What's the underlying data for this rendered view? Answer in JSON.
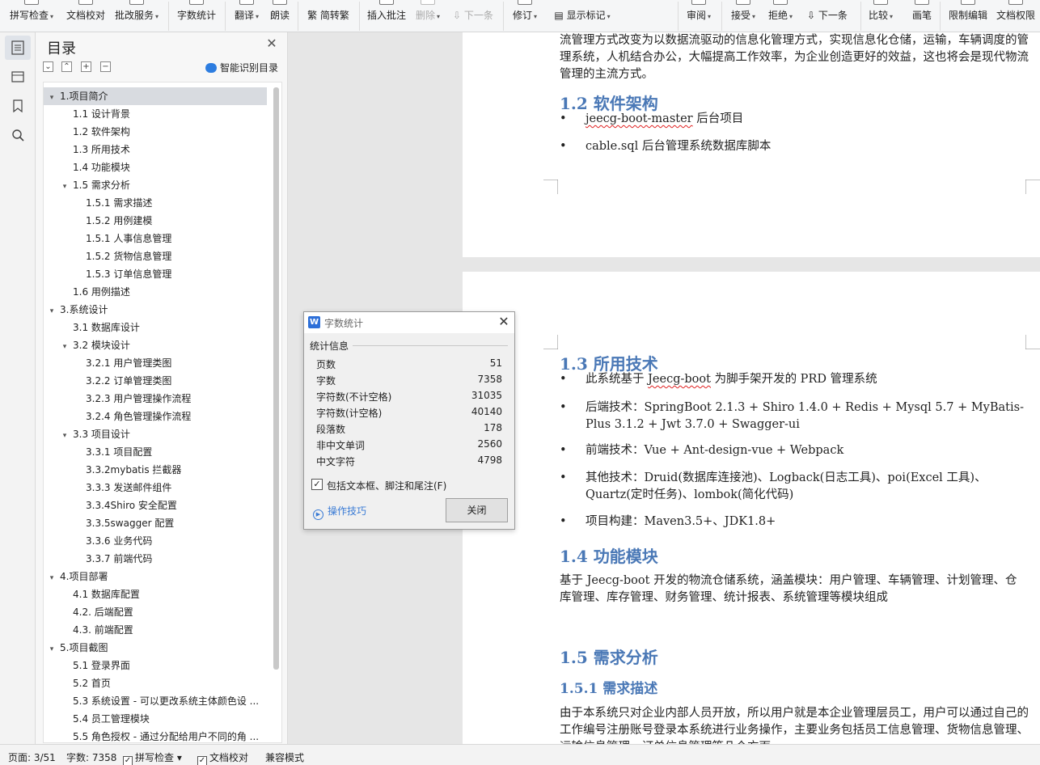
{
  "ribbon": {
    "spellcheck": "拼写检查",
    "doc_proof": "文档校对",
    "annot_service": "批改服务",
    "word_count": "字数统计",
    "translate": "翻译",
    "read_aloud": "朗读",
    "trad_simp": "简转繁",
    "insert_comment": "插入批注",
    "delete": "删除",
    "next_item": "下一条",
    "track_changes": "修订",
    "show_markup": "显示标记",
    "review": "审阅",
    "accept": "接受",
    "reject": "拒绝",
    "next_change": "下一条",
    "compare": "比较",
    "pen": "画笔",
    "restrict_edit": "限制编辑",
    "doc_permission": "文档权限"
  },
  "toc": {
    "title": "目录",
    "smart_label": "智能识别目录",
    "items": [
      {
        "level": 1,
        "toggle": "▾",
        "label": "1.项目简介",
        "selected": true
      },
      {
        "level": 2,
        "label": "1.1 设计背景"
      },
      {
        "level": 2,
        "label": "1.2 软件架构"
      },
      {
        "level": 2,
        "label": "1.3 所用技术"
      },
      {
        "level": 2,
        "label": "1.4 功能模块"
      },
      {
        "level": 2,
        "toggle": "▾",
        "label": "1.5 需求分析"
      },
      {
        "level": 3,
        "label": "1.5.1 需求描述"
      },
      {
        "level": 3,
        "label": "1.5.2 用例建模"
      },
      {
        "level": 3,
        "label": "1.5.1 人事信息管理"
      },
      {
        "level": 3,
        "label": "1.5.2 货物信息管理"
      },
      {
        "level": 3,
        "label": "1.5.3 订单信息管理"
      },
      {
        "level": 2,
        "label": "1.6 用例描述"
      },
      {
        "level": 1,
        "toggle": "▾",
        "label": "3.系统设计"
      },
      {
        "level": 2,
        "label": "3.1 数据库设计"
      },
      {
        "level": 2,
        "toggle": "▾",
        "label": "3.2 模块设计"
      },
      {
        "level": 3,
        "label": "3.2.1 用户管理类图"
      },
      {
        "level": 3,
        "label": "3.2.2 订单管理类图"
      },
      {
        "level": 3,
        "label": "3.2.3 用户管理操作流程"
      },
      {
        "level": 3,
        "label": "3.2.4 角色管理操作流程"
      },
      {
        "level": 2,
        "toggle": "▾",
        "label": "3.3 项目设计"
      },
      {
        "level": 3,
        "label": "3.3.1 项目配置"
      },
      {
        "level": 3,
        "label": "3.3.2mybatis 拦截器"
      },
      {
        "level": 3,
        "label": "3.3.3 发送邮件组件"
      },
      {
        "level": 3,
        "label": "3.3.4Shiro 安全配置"
      },
      {
        "level": 3,
        "label": "3.3.5swagger 配置"
      },
      {
        "level": 3,
        "label": "3.3.6 业务代码"
      },
      {
        "level": 3,
        "label": "3.3.7 前端代码"
      },
      {
        "level": 1,
        "toggle": "▾",
        "label": "4.项目部署"
      },
      {
        "level": 2,
        "label": "4.1 数据库配置"
      },
      {
        "level": 2,
        "label": "4.2. 后端配置"
      },
      {
        "level": 2,
        "label": "4.3. 前端配置"
      },
      {
        "level": 1,
        "toggle": "▾",
        "label": "5.项目截图"
      },
      {
        "level": 2,
        "label": "5.1 登录界面"
      },
      {
        "level": 2,
        "label": "5.2 首页"
      },
      {
        "level": 2,
        "label": "5.3 系统设置 - 可以更改系统主体颜色设 ..."
      },
      {
        "level": 2,
        "label": "5.4 员工管理模块"
      },
      {
        "level": 2,
        "label": "5.5 角色授权 - 通过分配给用户不同的角 ..."
      }
    ]
  },
  "doc": {
    "p_intro": "流管理方式改变为以数据流驱动的信息化管理方式，实现信息化仓储，运输，车辆调度的管理系统，人机结合办公，大幅提高工作效率，为企业创造更好的效益，这也将会是现代物流管理的主流方式。",
    "h_12": "1.2 软件架构",
    "arch_1_a": "jeecg-boot-master",
    "arch_1_b": " 后台项目",
    "arch_2": "cable.sql 后台管理系统数据库脚本",
    "h_13": "1.3 所用技术",
    "tech_1_a": "此系统基于 ",
    "tech_1_b": "Jeecg-boot",
    "tech_1_c": " 为脚手架开发的 PRD 管理系统",
    "tech_2": "后端技术：SpringBoot 2.1.3 + Shiro 1.4.0 + Redis + Mysql 5.7 + MyBatis-Plus 3.1.2 + Jwt 3.7.0 + Swagger-ui",
    "tech_3": "前端技术：Vue + Ant-design-vue + Webpack",
    "tech_4": "其他技术：Druid(数据库连接池)、Logback(日志工具)、poi(Excel 工具)、Quartz(定时任务)、lombok(简化代码)",
    "tech_5": "项目构建：Maven3.5+、JDK1.8+",
    "h_14": "1.4 功能模块",
    "p_14": "基于 Jeecg-boot 开发的物流仓储系统，涵盖模块：用户管理、车辆管理、计划管理、仓库管理、库存管理、财务管理、统计报表、系统管理等模块组成",
    "h_15": "1.5 需求分析",
    "h_151": "1.5.1 需求描述",
    "p_151": "由于本系统只对企业内部人员开放，所以用户就是本企业管理层员工，用户可以通过自己的工作编号注册账号登录本系统进行业务操作，主要业务包括员工信息管理、货物信息管理、运输信息管理、订单信息管理等几个方面。",
    "bullet": "•"
  },
  "dialog": {
    "title": "字数统计",
    "group": "统计信息",
    "stats": [
      {
        "label": "页数",
        "value": "51"
      },
      {
        "label": "字数",
        "value": "7358"
      },
      {
        "label": "字符数(不计空格)",
        "value": "31035"
      },
      {
        "label": "字符数(计空格)",
        "value": "40140"
      },
      {
        "label": "段落数",
        "value": "178"
      },
      {
        "label": "非中文单词",
        "value": "2560"
      },
      {
        "label": "中文字符",
        "value": "4798"
      }
    ],
    "include_label": "包括文本框、脚注和尾注(F)",
    "include_checked": "✓",
    "tips": "操作技巧",
    "close": "关闭"
  },
  "status": {
    "page": "页面: 3/51",
    "words": "字数: 7358",
    "spell": "拼写检查",
    "proof": "文档校对",
    "compat": "兼容模式",
    "check": "✓"
  },
  "colors": {
    "heading": "#4a78b6",
    "link": "#3a7bd5",
    "squiggle": "#e02020"
  }
}
